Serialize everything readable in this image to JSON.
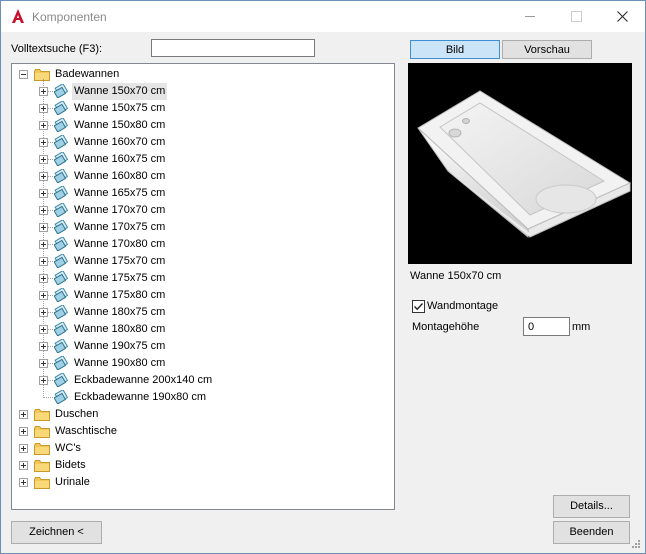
{
  "window": {
    "title": "Komponenten",
    "app_icon": "autocad-a-icon",
    "controls": [
      "minimize-icon",
      "maximize-icon",
      "close-icon"
    ]
  },
  "search": {
    "label": "Volltextsuche (F3):",
    "value": ""
  },
  "tree": {
    "root": {
      "label": "Badewannen",
      "items": [
        {
          "label": "Wanne 150x70 cm",
          "selected": true
        },
        {
          "label": "Wanne 150x75 cm"
        },
        {
          "label": "Wanne 150x80 cm"
        },
        {
          "label": "Wanne 160x70 cm"
        },
        {
          "label": "Wanne 160x75 cm"
        },
        {
          "label": "Wanne 160x80 cm"
        },
        {
          "label": "Wanne 165x75 cm"
        },
        {
          "label": "Wanne 170x70 cm"
        },
        {
          "label": "Wanne 170x75 cm"
        },
        {
          "label": "Wanne 170x80 cm"
        },
        {
          "label": "Wanne 175x70 cm"
        },
        {
          "label": "Wanne 175x75 cm"
        },
        {
          "label": "Wanne 175x80 cm"
        },
        {
          "label": "Wanne 180x75 cm"
        },
        {
          "label": "Wanne 180x80 cm"
        },
        {
          "label": "Wanne 190x75 cm"
        },
        {
          "label": "Wanne 190x80 cm"
        },
        {
          "label": "Eckbadewanne 200x140 cm"
        },
        {
          "label": "Eckbadewanne 190x80 cm",
          "no_expander": true
        }
      ]
    },
    "groups": [
      "Duschen",
      "Waschtische",
      "WC's",
      "Bidets",
      "Urinale"
    ]
  },
  "tabs": {
    "bild": "Bild",
    "vorschau": "Vorschau",
    "active": "bild"
  },
  "preview": {
    "caption": "Wanne 150x70 cm"
  },
  "options": {
    "wandmontage": {
      "label": "Wandmontage",
      "checked": true
    },
    "montagehoehe": {
      "label": "Montagehöhe",
      "value": "0",
      "unit": "mm"
    }
  },
  "buttons": {
    "details": "Details...",
    "beenden": "Beenden",
    "zeichnen": "Zeichnen <"
  }
}
